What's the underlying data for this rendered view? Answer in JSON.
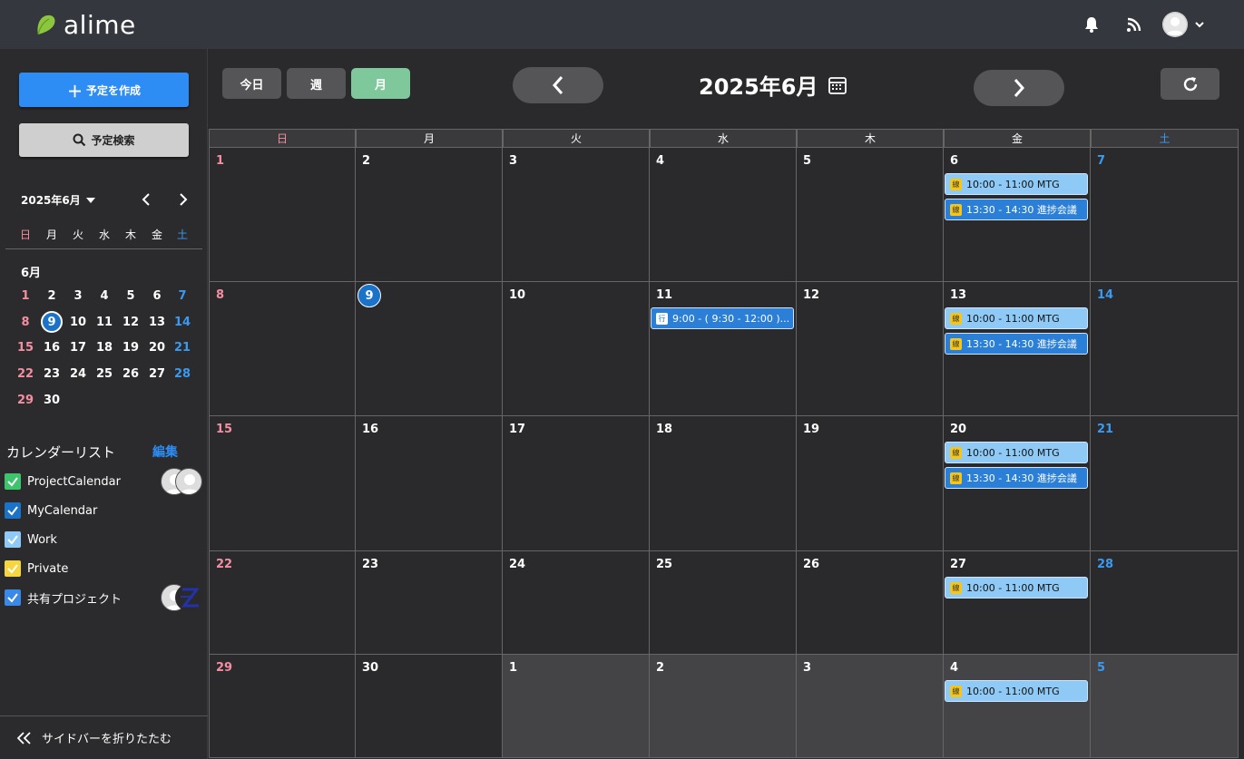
{
  "app": {
    "name": "alime"
  },
  "header": {
    "bell_icon": "bell-icon",
    "rss_icon": "rss-icon",
    "user_icon": "user-avatar-icon"
  },
  "sidebar": {
    "create_label": "予定を作成",
    "search_label": "予定検索",
    "mini_calendar": {
      "title": "2025年6月",
      "weekdays": [
        "日",
        "月",
        "火",
        "水",
        "木",
        "金",
        "土"
      ],
      "month_label": "6月",
      "weeks": [
        [
          "1",
          "2",
          "3",
          "4",
          "5",
          "6",
          "7"
        ],
        [
          "8",
          "9",
          "10",
          "11",
          "12",
          "13",
          "14"
        ],
        [
          "15",
          "16",
          "17",
          "18",
          "19",
          "20",
          "21"
        ],
        [
          "22",
          "23",
          "24",
          "25",
          "26",
          "27",
          "28"
        ],
        [
          "29",
          "30",
          "",
          "",
          "",
          "",
          ""
        ]
      ],
      "today": "9"
    },
    "calendar_list": {
      "title": "カレンダーリスト",
      "edit_label": "編集",
      "items": [
        {
          "label": "ProjectCalendar",
          "color": "#3ec46d"
        },
        {
          "label": "MyCalendar",
          "color": "#1a73c8"
        },
        {
          "label": "Work",
          "color": "#8ecaf5"
        },
        {
          "label": "Private",
          "color": "#f5d640"
        },
        {
          "label": "共有プロジェクト",
          "color": "#3a88e8"
        }
      ]
    },
    "collapse_label": "サイドバーを折りたたむ"
  },
  "toolbar": {
    "today_label": "今日",
    "week_label": "週",
    "month_label": "月",
    "title": "2025年6月"
  },
  "calendar": {
    "weekdays": [
      "日",
      "月",
      "火",
      "水",
      "木",
      "金",
      "土"
    ],
    "weeks": [
      {
        "days": [
          "1",
          "2",
          "3",
          "4",
          "5",
          "6",
          "7"
        ]
      },
      {
        "days": [
          "8",
          "9",
          "10",
          "11",
          "12",
          "13",
          "14"
        ]
      },
      {
        "days": [
          "15",
          "16",
          "17",
          "18",
          "19",
          "20",
          "21"
        ]
      },
      {
        "days": [
          "22",
          "23",
          "24",
          "25",
          "26",
          "27",
          "28"
        ]
      },
      {
        "days": [
          "29",
          "30",
          "1",
          "2",
          "3",
          "4",
          "5"
        ]
      }
    ],
    "events": {
      "w0_fri_1": {
        "tag": "線",
        "text": "10:00 - 11:00 MTG"
      },
      "w0_fri_2": {
        "tag": "線",
        "text": "13:30 - 14:30 進捗会議"
      },
      "w1_wed_1": {
        "tag": "行",
        "text": "9:00 - ( 9:30 - 12:00 )..."
      },
      "w1_fri_1": {
        "tag": "線",
        "text": "10:00 - 11:00 MTG"
      },
      "w1_fri_2": {
        "tag": "線",
        "text": "13:30 - 14:30 進捗会議"
      },
      "w2_fri_1": {
        "tag": "線",
        "text": "10:00 - 11:00 MTG"
      },
      "w2_fri_2": {
        "tag": "線",
        "text": "13:30 - 14:30 進捗会議"
      },
      "w3_fri_1": {
        "tag": "線",
        "text": "10:00 - 11:00 MTG"
      },
      "w4_fri_1": {
        "tag": "線",
        "text": "10:00 - 11:00 MTG"
      }
    }
  }
}
